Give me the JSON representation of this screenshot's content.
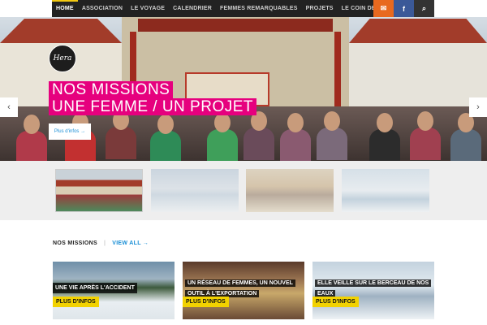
{
  "nav": {
    "items": [
      {
        "label": "HOME",
        "active": true
      },
      {
        "label": "ASSOCIATION"
      },
      {
        "label": "LE VOYAGE"
      },
      {
        "label": "CALENDRIER"
      },
      {
        "label": "FEMMES REMARQUABLES"
      },
      {
        "label": "PROJETS"
      },
      {
        "label": "LE COIN DES NEWS"
      }
    ],
    "icons": [
      "mail-icon",
      "facebook-icon",
      "search-icon"
    ],
    "icon_glyphs": {
      "mail": "✉",
      "facebook": "f",
      "search": "⌕"
    }
  },
  "hero": {
    "logo_text": "Hera",
    "title_line1": "NOS MISSIONS",
    "title_line2": "UNE FEMME / UN PROJET",
    "button_label": "Plus d'infos →",
    "prev_arrow": "‹",
    "next_arrow": "›"
  },
  "thumbnails": [
    "group-photo",
    "snowy-palace",
    "pavilion",
    "frozen-lake"
  ],
  "missions": {
    "title": "NOS MISSIONS",
    "separator": "|",
    "view_all": "VIEW ALL →",
    "cards": [
      {
        "title": "UNE VIE APRÈS L'ACCIDENT",
        "button": "PLUS D'INFOS"
      },
      {
        "title": "UN RÉSEAU DE FEMMES, UN NOUVEL OUTIL À L'EXPORTATION",
        "button": "PLUS D'INFOS"
      },
      {
        "title": "ELLE VEILLE SUR LE BERCEAU DE NOS EAUX",
        "button": "PLUS D'INFOS"
      }
    ]
  },
  "colors": {
    "accent_magenta": "#e6007e",
    "link_blue": "#1a8fd6",
    "button_yellow": "#f2d200",
    "nav_bg": "#222222",
    "mail_orange": "#e8691f",
    "facebook_blue": "#3b5998"
  }
}
